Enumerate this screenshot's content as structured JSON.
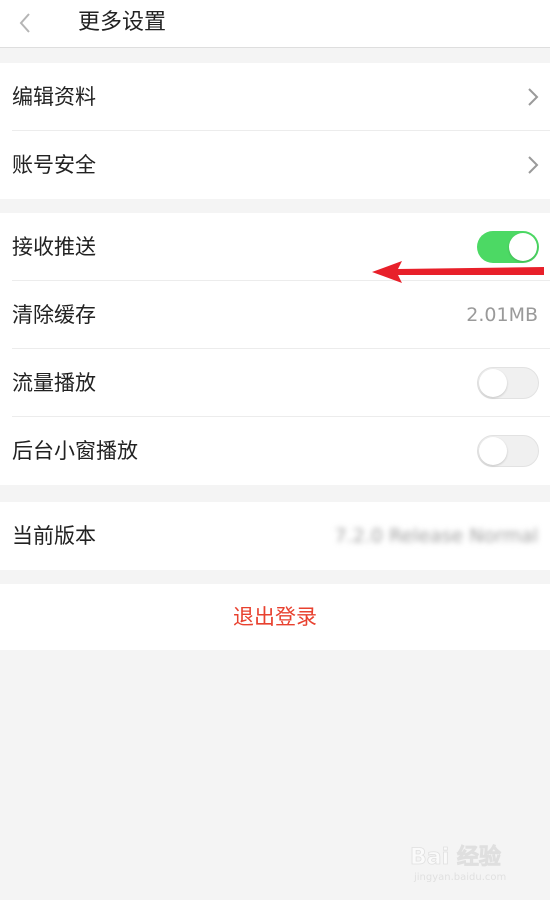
{
  "header": {
    "title": "更多设置",
    "back_icon": "chevron-left-icon"
  },
  "sections": {
    "account": {
      "edit_profile": {
        "label": "编辑资料",
        "icon": "chevron-right-icon"
      },
      "account_security": {
        "label": "账号安全",
        "icon": "chevron-right-icon"
      }
    },
    "preferences": {
      "receive_push": {
        "label": "接收推送",
        "toggle": "on"
      },
      "clear_cache": {
        "label": "清除缓存",
        "value": "2.01MB"
      },
      "data_playback": {
        "label": "流量播放",
        "toggle": "off"
      },
      "background_window": {
        "label": "后台小窗播放",
        "toggle": "off"
      }
    },
    "about": {
      "current_version": {
        "label": "当前版本",
        "value": "7.2.0 Release Normal"
      }
    },
    "logout": {
      "label": "退出登录"
    }
  },
  "watermark": {
    "logo_text": "Bai 经验",
    "url_text": "jingyan.baidu.com"
  },
  "colors": {
    "toggle_on": "#4cd964",
    "toggle_off": "#f0f0f0",
    "logout_text": "#e8412f",
    "annotation_arrow": "#e8202a",
    "page_background": "#f4f4f4"
  }
}
